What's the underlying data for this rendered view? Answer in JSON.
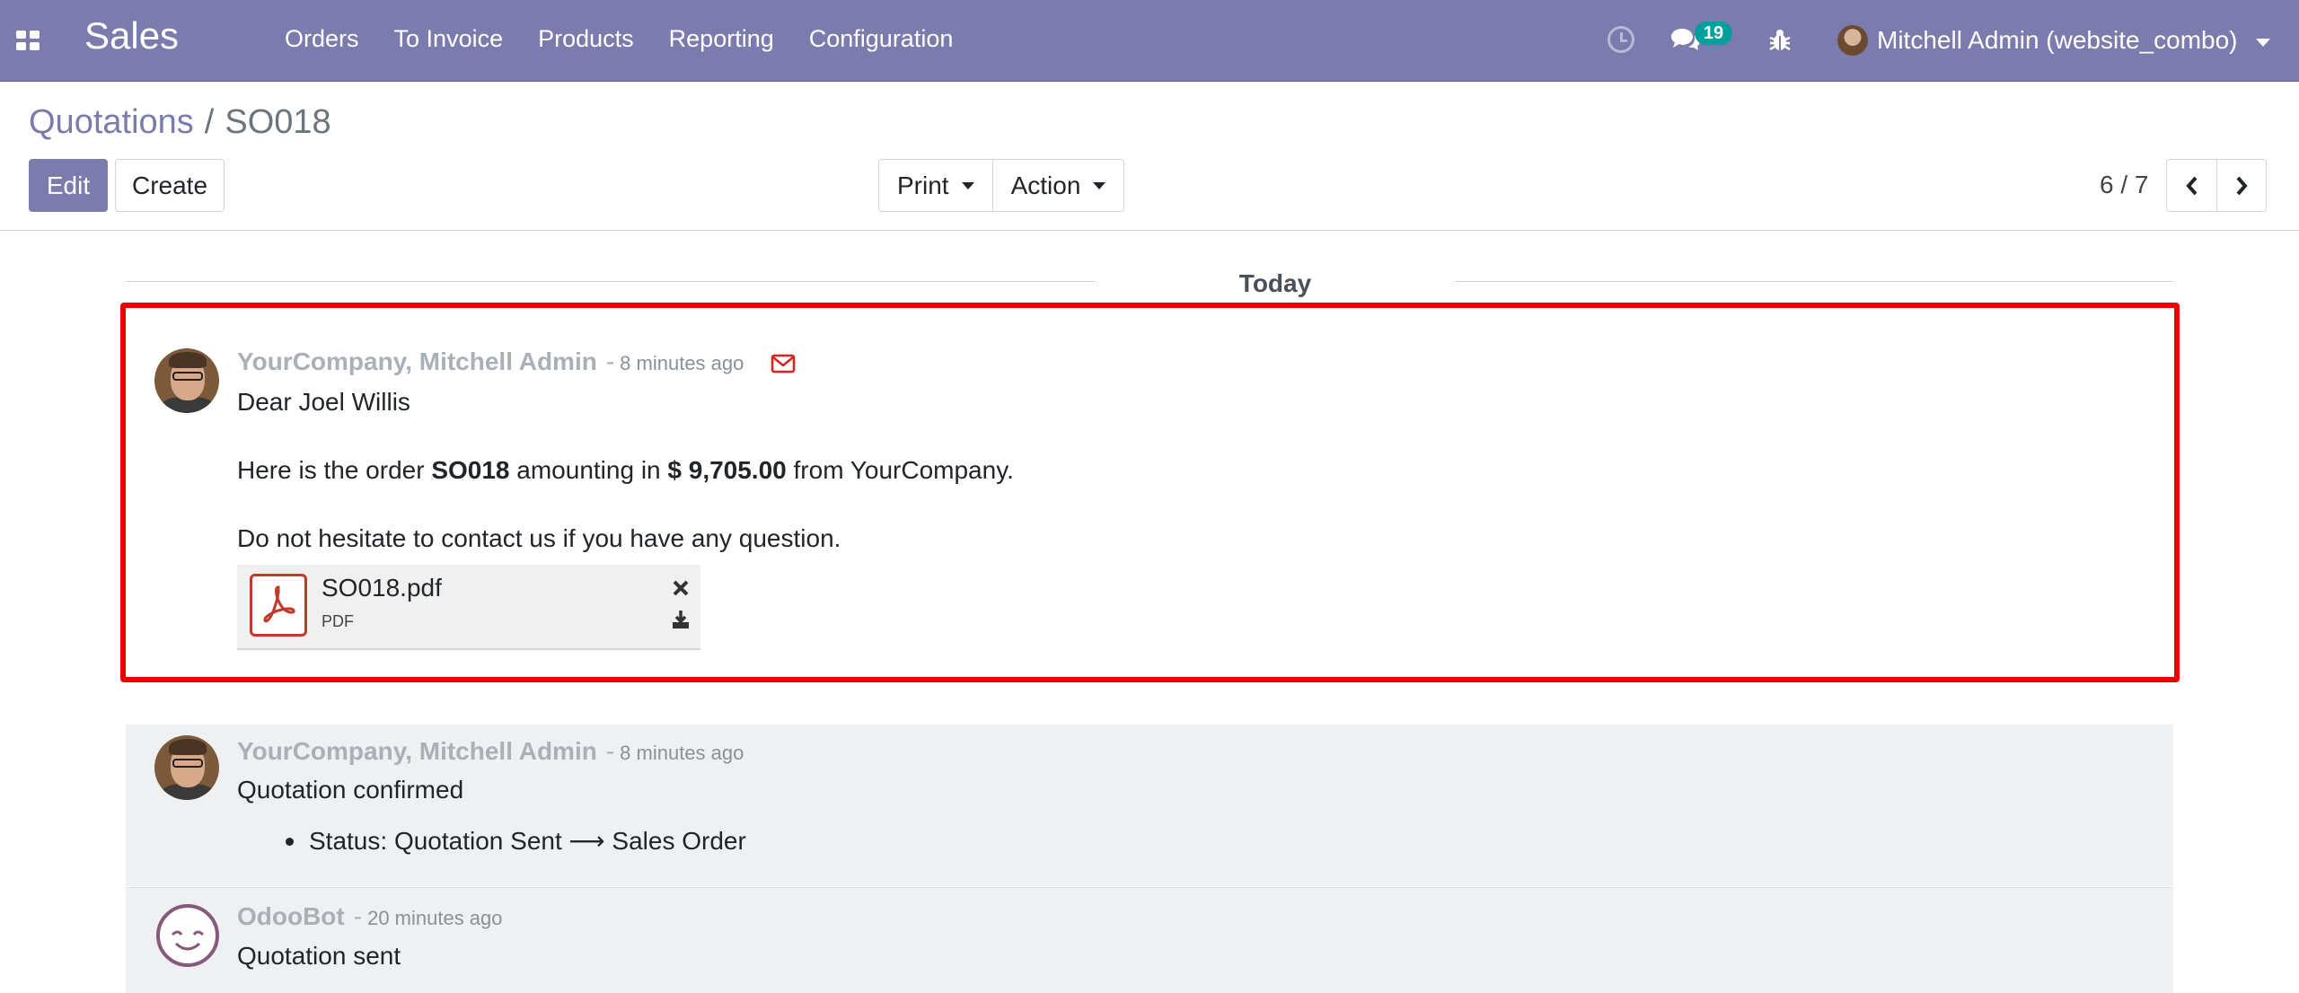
{
  "navbar": {
    "app_name": "Sales",
    "menu": [
      "Orders",
      "To Invoice",
      "Products",
      "Reporting",
      "Configuration"
    ],
    "messages_badge": "19",
    "user_name": "Mitchell Admin (website_combo)",
    "colors": {
      "background": "#7c7bad",
      "badge": "#00a09d"
    },
    "icons": [
      "apps-icon",
      "activity-clock-icon",
      "chat-icon",
      "bug-icon",
      "user-avatar",
      "caret-down-icon"
    ]
  },
  "breadcrumb": {
    "parent": "Quotations",
    "separator": "/",
    "current": "SO018"
  },
  "buttons": {
    "edit": "Edit",
    "create": "Create",
    "print": "Print",
    "action": "Action"
  },
  "pager": {
    "value": "6 / 7",
    "icons": [
      "chevron-left-icon",
      "chevron-right-icon"
    ]
  },
  "chatter": {
    "day_separator": "Today",
    "messages": [
      {
        "author": "YourCompany, Mitchell Admin",
        "dash": "-",
        "date": "8 minutes ago",
        "type_icon": "envelope-icon",
        "greeting": "Dear Joel Willis",
        "line1_part1": "Here is the order ",
        "order_ref": "SO018",
        "line1_part2": " amounting in ",
        "amount": "$ 9,705.00",
        "line1_part3": " from YourCompany.",
        "line2": "Do not hesitate to contact us if you have any question.",
        "attachment": {
          "name": "SO018.pdf",
          "ext": "PDF",
          "icon": "pdf-file-icon"
        }
      },
      {
        "author": "YourCompany, Mitchell Admin",
        "dash": "-",
        "date": "8 minutes ago",
        "body": "Quotation confirmed",
        "tracking": "Status: Quotation Sent ⟶ Sales Order"
      },
      {
        "author": "OdooBot",
        "dash": "-",
        "date": "20 minutes ago",
        "body": "Quotation sent"
      }
    ]
  },
  "highlight_color": "#ee0000"
}
